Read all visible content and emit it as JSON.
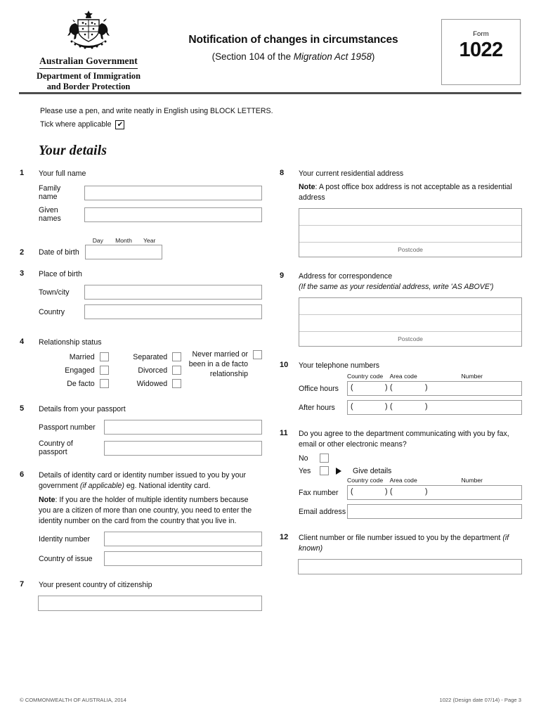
{
  "header": {
    "government": "Australian Government",
    "department_line1": "Department of Immigration",
    "department_line2": "and Border Protection",
    "title": "Notification of changes in circumstances",
    "subtitle_prefix": "(Section 104 of the ",
    "subtitle_italic": "Migration Act 1958",
    "subtitle_suffix": ")",
    "form_word": "Form",
    "form_number": "1022"
  },
  "intro": {
    "line1": "Please use a pen, and write neatly in English using BLOCK LETTERS.",
    "tick_label": "Tick where applicable",
    "tick_mark": "✔"
  },
  "section": {
    "title": "Your details"
  },
  "left": {
    "q1": {
      "num": "1",
      "label": "Your full name",
      "family_label": "Family name",
      "family_value": "",
      "given_label": "Given names",
      "given_value": ""
    },
    "q2": {
      "num": "2",
      "label": "Date of birth",
      "day": "Day",
      "month": "Month",
      "year": "Year",
      "value": ""
    },
    "q3": {
      "num": "3",
      "label": "Place of birth",
      "town_label": "Town/city",
      "town_value": "",
      "country_label": "Country",
      "country_value": ""
    },
    "q4": {
      "num": "4",
      "label": "Relationship status",
      "options_col1": [
        "Married",
        "Engaged",
        "De facto"
      ],
      "options_col2": [
        "Separated",
        "Divorced",
        "Widowed"
      ],
      "option_never_line1": "Never married or",
      "option_never_line2": "been in a de facto",
      "option_never_line3": "relationship"
    },
    "q5": {
      "num": "5",
      "label": "Details from your passport",
      "passport_label": "Passport number",
      "passport_value": "",
      "country_label": "Country of passport",
      "country_value": ""
    },
    "q6": {
      "num": "6",
      "label_line1": "Details of identity card or identity number issued to you by your",
      "label_italic": "(if applicable)",
      "label_line2_pre": "government ",
      "label_line2_post": " eg. National identity card.",
      "note_word": "Note",
      "note_text": ": If you are the holder of multiple identity numbers because you are a citizen of more than one country, you need to enter the identity number on the card from the country that you live in.",
      "identity_label": "Identity number",
      "identity_value": "",
      "issue_label": "Country of issue",
      "issue_value": ""
    },
    "q7": {
      "num": "7",
      "label": "Your present country of citizenship",
      "value": ""
    }
  },
  "right": {
    "q8": {
      "num": "8",
      "label": "Your current residential address",
      "note_word": "Note",
      "note_text": ": A post office box address is not acceptable as a residential address",
      "postcode_label": "Postcode",
      "line1": "",
      "line2": "",
      "postcode_value": ""
    },
    "q9": {
      "num": "9",
      "label": "Address for correspondence",
      "sublabel": "(If the same as your residential address, write 'AS ABOVE')",
      "postcode_label": "Postcode",
      "line1": "",
      "line2": "",
      "postcode_value": ""
    },
    "q10": {
      "num": "10",
      "label": "Your telephone numbers",
      "country_code": "Country code",
      "area_code": "Area code",
      "number": "Number",
      "office_label": "Office hours",
      "office_value": "",
      "after_label": "After hours",
      "after_value": "",
      "paren_open": "(",
      "paren_close": ")"
    },
    "q11": {
      "num": "11",
      "label_line1": "Do you agree to the department communicating with you by fax, email",
      "label_line2": "or other electronic means?",
      "no_label": "No",
      "yes_label": "Yes",
      "give_details": "Give details",
      "country_code": "Country code",
      "area_code": "Area code",
      "number": "Number",
      "fax_label": "Fax number",
      "fax_value": "",
      "email_label": "Email address",
      "email_value": ""
    },
    "q12": {
      "num": "12",
      "label_main": "Client number or file number issued to you by the department ",
      "label_italic": "(if known)",
      "value": ""
    }
  },
  "footer": {
    "copyright": "© COMMONWEALTH OF AUSTRALIA, 2014",
    "page_info": "1022 (Design date 07/14) - Page 3"
  },
  "colors": {
    "rule": "#4d4d4d",
    "box_border": "#9a9a9a",
    "text": "#111111"
  }
}
